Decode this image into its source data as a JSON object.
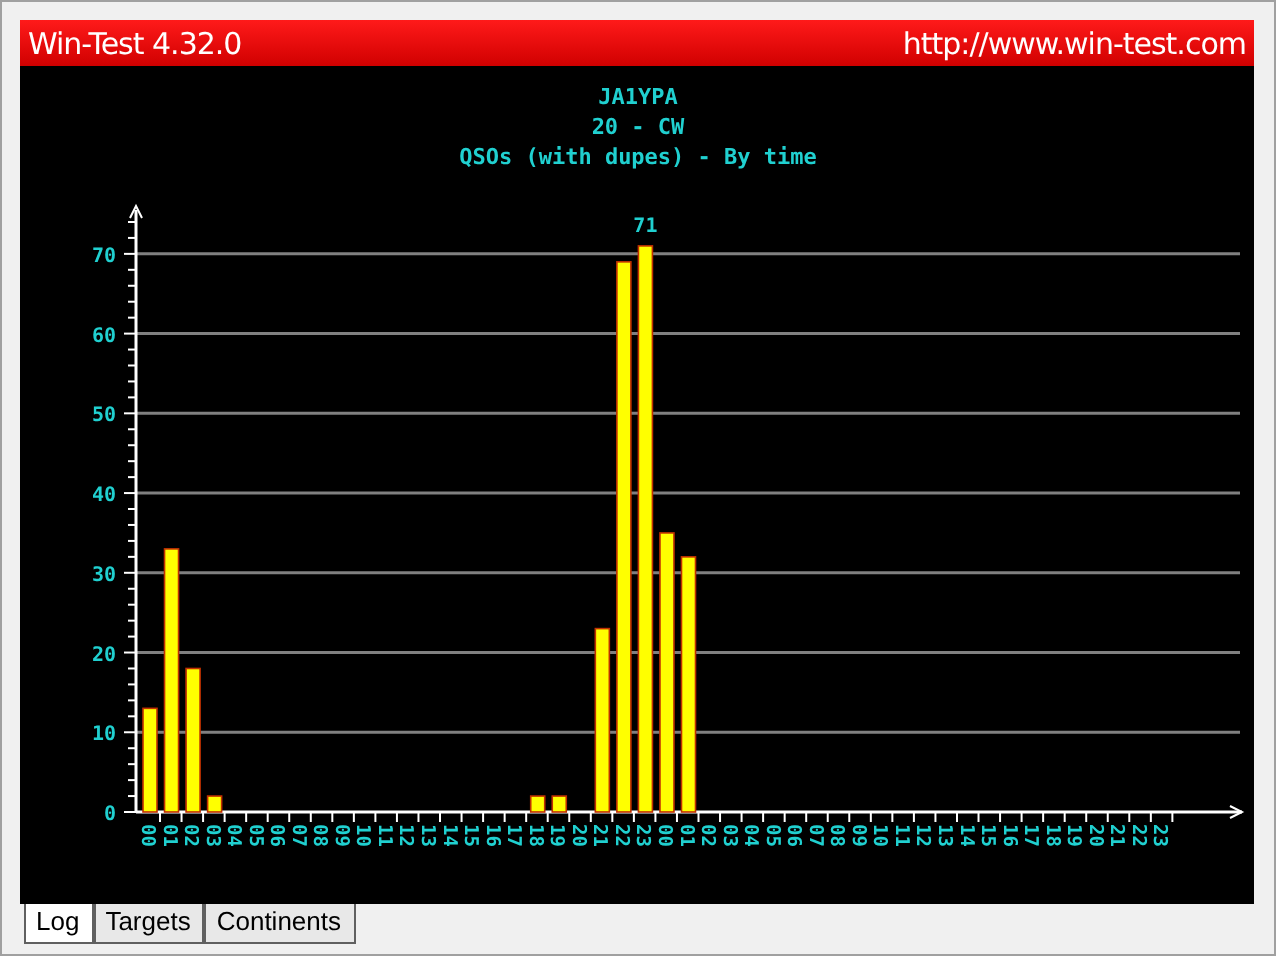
{
  "window": {
    "title": "Win-Test 4.32.0",
    "url": "http://www.win-test.com"
  },
  "chart": {
    "chart_data": {
      "type": "bar",
      "title": [
        "JA1YPA",
        "20 - CW",
        "QSOs (with dupes) - By time"
      ],
      "categories": [
        "00",
        "01",
        "02",
        "03",
        "04",
        "05",
        "06",
        "07",
        "08",
        "09",
        "10",
        "11",
        "12",
        "13",
        "14",
        "15",
        "16",
        "17",
        "18",
        "19",
        "20",
        "21",
        "22",
        "23",
        "00",
        "01",
        "02",
        "03",
        "04",
        "05",
        "06",
        "07",
        "08",
        "09",
        "10",
        "11",
        "12",
        "13",
        "14",
        "15",
        "16",
        "17",
        "18",
        "19",
        "20",
        "21",
        "22",
        "23"
      ],
      "series": [
        {
          "color": "#ffff00",
          "values": [
            13,
            33,
            18,
            2,
            0,
            0,
            0,
            0,
            0,
            0,
            0,
            0,
            0,
            0,
            0,
            0,
            0,
            0,
            2,
            2,
            0,
            23,
            69,
            71,
            35,
            32,
            0,
            0,
            0,
            0,
            0,
            0,
            0,
            0,
            0,
            0,
            0,
            0,
            0,
            0,
            0,
            0,
            0,
            0,
            0,
            0,
            0,
            0
          ]
        }
      ],
      "ylim": [
        0,
        75
      ],
      "yticks": [
        0,
        10,
        20,
        30,
        40,
        50,
        60,
        70
      ],
      "grid": true,
      "annotations": [
        "71"
      ]
    }
  },
  "tabs": [
    {
      "label": "Log",
      "selected": true
    },
    {
      "label": "Targets",
      "selected": false
    },
    {
      "label": "Continents",
      "selected": false
    }
  ]
}
